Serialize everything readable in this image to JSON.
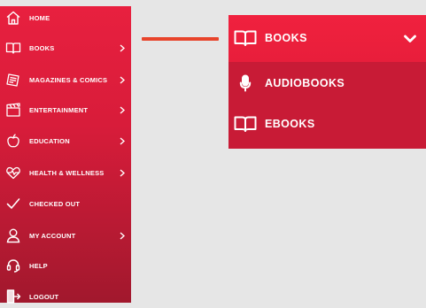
{
  "sidebar": {
    "items": [
      {
        "label": "HOME",
        "icon": "home-icon",
        "has_chevron": false
      },
      {
        "label": "BOOKS",
        "icon": "book-icon",
        "has_chevron": true
      },
      {
        "label": "MAGAZINES & COMICS",
        "icon": "magazine-icon",
        "has_chevron": true
      },
      {
        "label": "ENTERTAINMENT",
        "icon": "clapperboard-icon",
        "has_chevron": true
      },
      {
        "label": "EDUCATION",
        "icon": "apple-icon",
        "has_chevron": true
      },
      {
        "label": "HEALTH & WELLNESS",
        "icon": "heartbeat-icon",
        "has_chevron": true
      },
      {
        "label": "CHECKED OUT",
        "icon": "checkmark-icon",
        "has_chevron": false
      },
      {
        "label": "MY ACCOUNT",
        "icon": "user-icon",
        "has_chevron": true
      },
      {
        "label": "HELP",
        "icon": "headset-icon",
        "has_chevron": false
      },
      {
        "label": "LOGOUT",
        "icon": "logout-icon",
        "has_chevron": false
      }
    ]
  },
  "dropdown": {
    "header": {
      "label": "BOOKS",
      "icon": "book-icon",
      "toggle_icon": "chevron-down-icon"
    },
    "items": [
      {
        "label": "AUDIOBOOKS",
        "icon": "microphone-icon"
      },
      {
        "label": "EBOOKS",
        "icon": "book-icon"
      }
    ]
  },
  "colors": {
    "accent": "#e8203f",
    "dark_accent": "#a1182d",
    "connector": "#e8442b",
    "background": "#e6e6e6",
    "text": "#ffffff"
  }
}
